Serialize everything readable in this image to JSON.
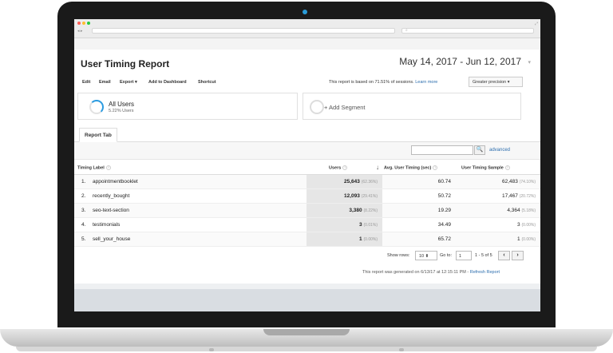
{
  "colors": {
    "accent": "#2b9be0",
    "link": "#2b6dad",
    "dot_red": "#ff5f57",
    "dot_yellow": "#ffbd2e",
    "dot_green": "#28c840"
  },
  "browser": {
    "nav_arrows": "◂ ▸",
    "search_glyph": "⌕",
    "resize_glyph": "⤢"
  },
  "header": {
    "title": "User Timing Report",
    "date_range": "May 14, 2017 - Jun 12, 2017",
    "date_caret": "▾"
  },
  "toolbar": {
    "edit": "Edit",
    "email": "Email",
    "export": "Export ▾",
    "add_dashboard": "Add to Dashboard",
    "shortcut": "Shortcut",
    "based_on_prefix": "This report is based on 71.51% of sessions.",
    "learn_more": "Learn more",
    "precision": "Greater precision ▾"
  },
  "segments": {
    "all_users": "All Users",
    "all_users_pct": "5.22% Users",
    "add_segment": "+ Add Segment"
  },
  "tabs": {
    "report_tab": "Report Tab"
  },
  "filter": {
    "advanced": "advanced",
    "search_glyph": "🔍"
  },
  "table": {
    "headers": {
      "timing_label": "Timing Label",
      "users": "Users",
      "avg_timing": "Avg. User Timing (sec)",
      "sample": "User Timing Sample",
      "help": "?",
      "sort": "↓"
    },
    "rows": [
      {
        "idx": "1.",
        "label": "appointmentbooklet",
        "users": "25,643",
        "users_pct": "(62.36%)",
        "avg": "60.74",
        "sample": "62,483",
        "sample_pct": "(74.10%)"
      },
      {
        "idx": "2.",
        "label": "recently_bought",
        "users": "12,093",
        "users_pct": "(29.41%)",
        "avg": "50.72",
        "sample": "17,467",
        "sample_pct": "(20.72%)"
      },
      {
        "idx": "3.",
        "label": "seo-text-section",
        "users": "3,380",
        "users_pct": "(8.22%)",
        "avg": "19.29",
        "sample": "4,364",
        "sample_pct": "(5.18%)"
      },
      {
        "idx": "4.",
        "label": "testimonials",
        "users": "3",
        "users_pct": "(0.01%)",
        "avg": "34.49",
        "sample": "3",
        "sample_pct": "(0.00%)"
      },
      {
        "idx": "5.",
        "label": "sell_your_house",
        "users": "1",
        "users_pct": "(0.00%)",
        "avg": "65.72",
        "sample": "1",
        "sample_pct": "(0.00%)"
      }
    ]
  },
  "pager": {
    "show_rows": "Show rows:",
    "rows_value": "10 ⬍",
    "go_to": "Go to:",
    "page_value": "1",
    "range": "1 - 5 of 5",
    "prev": "‹",
    "next": "›"
  },
  "footer": {
    "generated": "This report was generated on 6/13/17 at 12:15:11 PM -",
    "refresh": "Refresh Report"
  }
}
